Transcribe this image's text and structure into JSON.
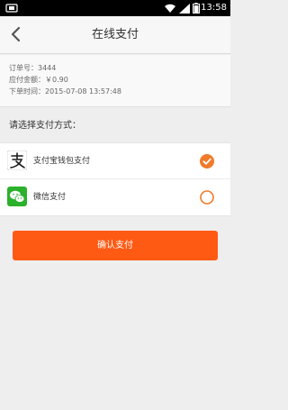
{
  "status_bar": {
    "time": "13:58"
  },
  "header": {
    "title": "在线支付"
  },
  "order": {
    "order_no": "订单号：3444",
    "amount": "应付金额：￥0.90",
    "order_time": "下单时间：2015-07-08 13:57:48"
  },
  "payment": {
    "prompt": "请选择支付方式：",
    "methods": [
      {
        "label": "支付宝钱包支付",
        "selected": true,
        "icon": "alipay-icon"
      },
      {
        "label": "微信支付",
        "selected": false,
        "icon": "wechat-icon"
      }
    ]
  },
  "confirm_label": "确认支付",
  "colors": {
    "accent": "#ff5a14",
    "check": "#f07a2a",
    "wechat": "#2bb12b"
  }
}
